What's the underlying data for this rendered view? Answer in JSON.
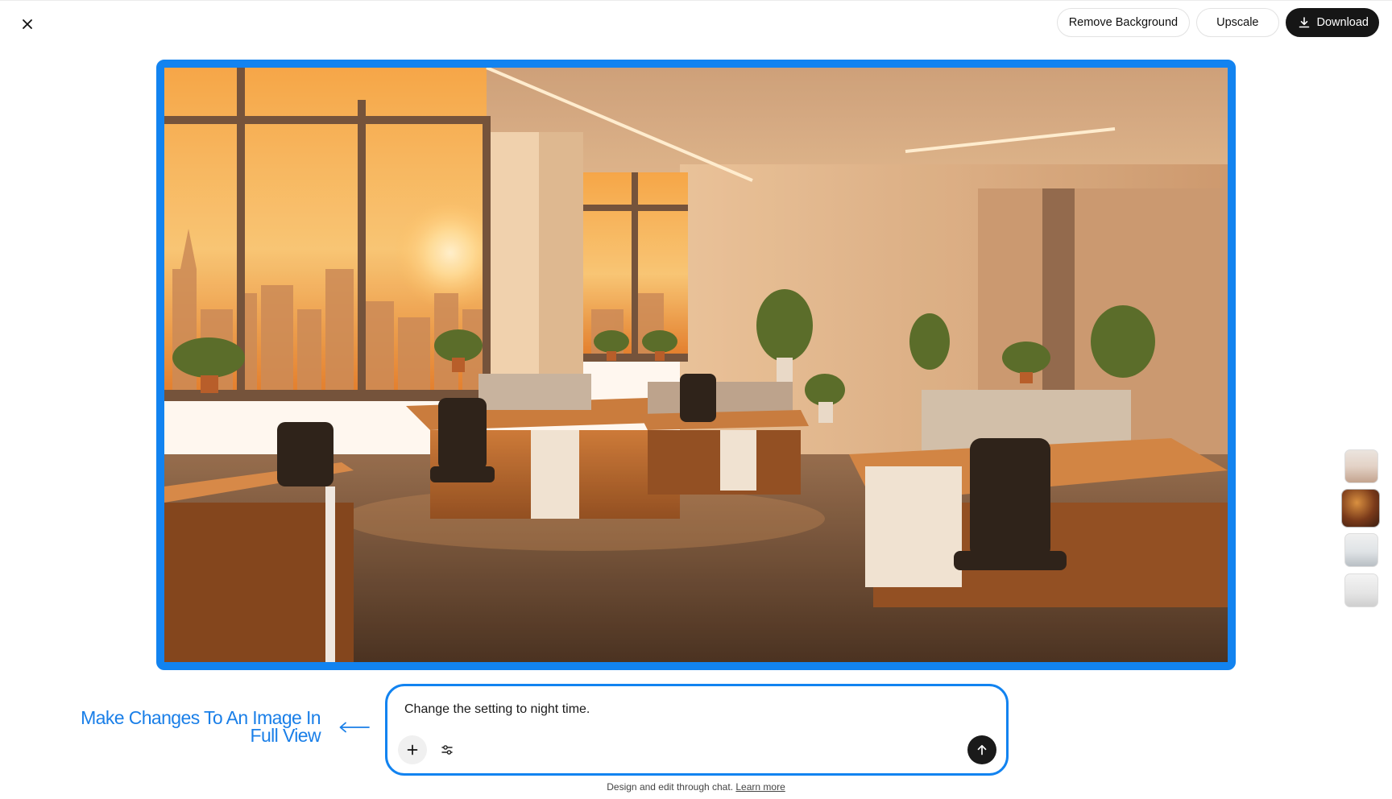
{
  "header": {
    "close_icon": "close-icon",
    "actions": {
      "remove_background": "Remove Background",
      "upscale": "Upscale",
      "download": "Download",
      "download_icon": "download-icon"
    }
  },
  "viewer": {
    "image_subject": "sunset-office-interior",
    "accent_color": "#1283f0",
    "thumbnails_count_visible": 4,
    "selected_thumbnail_index": 1
  },
  "annotation": {
    "callout_line1": "Make Changes To An Image In",
    "callout_line2": "Full View",
    "arrow_icon": "left-arrow-icon"
  },
  "prompt": {
    "text": "Change the setting to night time.",
    "add_icon": "plus-icon",
    "settings_icon": "sliders-icon",
    "send_icon": "arrow-up-icon"
  },
  "footer": {
    "note": "Design and edit through chat.",
    "link": "Learn more"
  }
}
